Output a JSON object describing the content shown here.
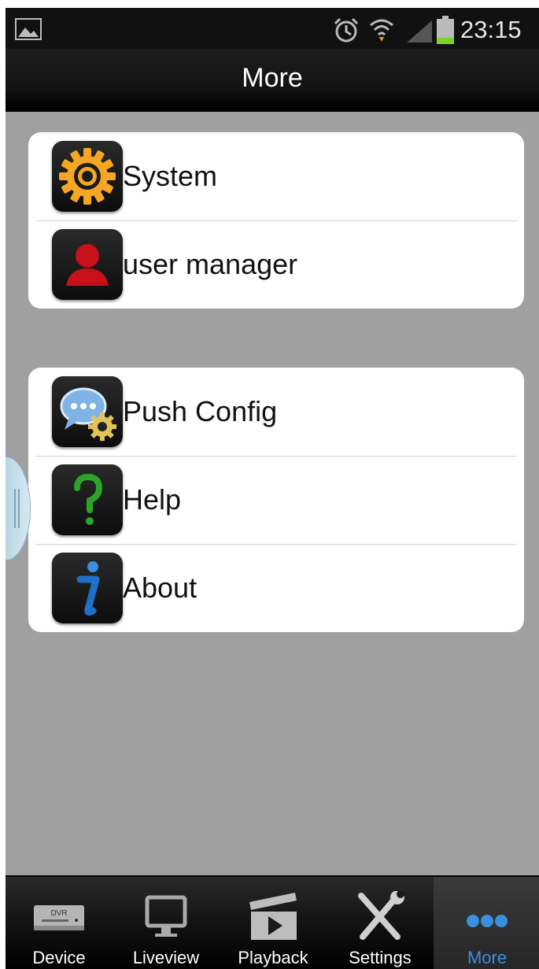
{
  "status_bar": {
    "time": "23:15",
    "icons": [
      "image-notification-icon",
      "alarm-icon",
      "wifi-icon",
      "signal-icon",
      "battery-icon"
    ]
  },
  "header": {
    "title": "More"
  },
  "groups": [
    {
      "items": [
        {
          "label": "System",
          "icon": "gear-icon"
        },
        {
          "label": "user manager",
          "icon": "user-icon"
        }
      ]
    },
    {
      "items": [
        {
          "label": "Push Config",
          "icon": "chat-settings-icon"
        },
        {
          "label": "Help",
          "icon": "question-mark-icon"
        },
        {
          "label": "About",
          "icon": "info-icon"
        }
      ]
    }
  ],
  "tabbar": {
    "active": "More",
    "accent": "#3b8fe0",
    "tabs": [
      {
        "label": "Device",
        "icon": "dvr-icon"
      },
      {
        "label": "Liveview",
        "icon": "monitor-icon"
      },
      {
        "label": "Playback",
        "icon": "clapperboard-icon"
      },
      {
        "label": "Settings",
        "icon": "tools-icon"
      },
      {
        "label": "More",
        "icon": "more-dots-icon"
      }
    ]
  }
}
